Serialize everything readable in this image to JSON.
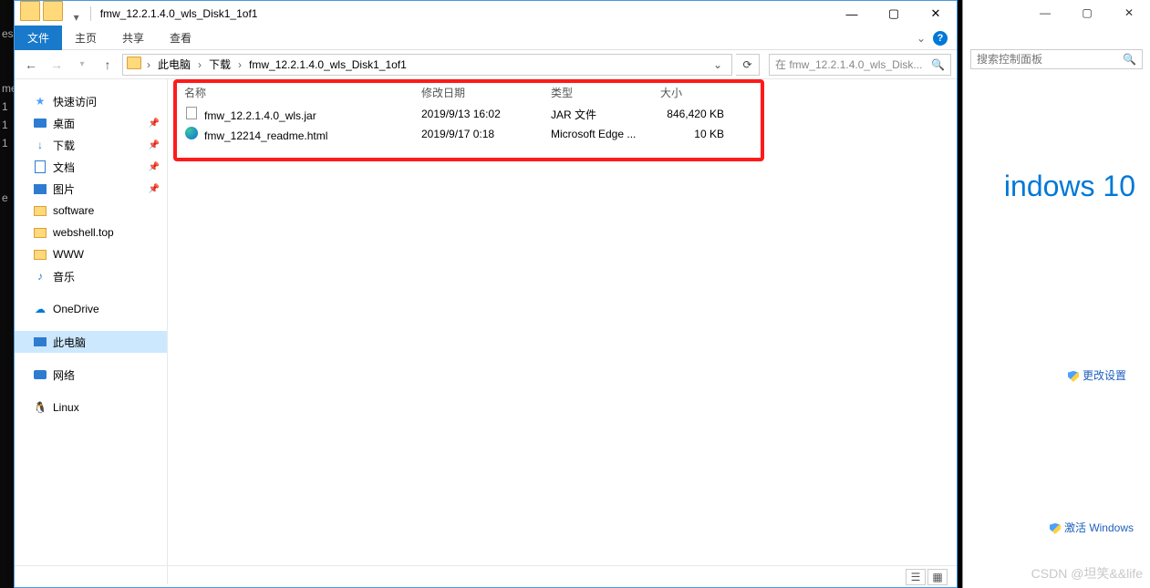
{
  "leftstrip": [
    "es",
    "",
    "",
    "me",
    "1",
    "1",
    "1",
    "",
    "",
    "e"
  ],
  "title": "fmw_12.2.1.4.0_wls_Disk1_1of1",
  "ribbon": {
    "file": "文件",
    "home": "主页",
    "share": "共享",
    "view": "查看"
  },
  "breadcrumbs": {
    "pc": "此电脑",
    "dl": "下载",
    "cur": "fmw_12.2.1.4.0_wls_Disk1_1of1"
  },
  "searchPlaceholder": "在 fmw_12.2.1.4.0_wls_Disk...",
  "cols": {
    "name": "名称",
    "date": "修改日期",
    "type": "类型",
    "size": "大小"
  },
  "rows": [
    {
      "icon": "jar",
      "name": "fmw_12.2.1.4.0_wls.jar",
      "date": "2019/9/13 16:02",
      "type": "JAR 文件",
      "size": "846,420 KB"
    },
    {
      "icon": "edge",
      "name": "fmw_12214_readme.html",
      "date": "2019/9/17 0:18",
      "type": "Microsoft Edge ...",
      "size": "10 KB"
    }
  ],
  "tree": {
    "quick": "快速访问",
    "desktop": "桌面",
    "downloads": "下载",
    "documents": "文档",
    "pictures": "图片",
    "software": "software",
    "webshell": "webshell.top",
    "www": "WWW",
    "music": "音乐",
    "onedrive": "OneDrive",
    "thispc": "此电脑",
    "network": "网络",
    "linux": "Linux"
  },
  "status": {
    "count": ""
  },
  "bg": {
    "searchPH": "搜索控制面板",
    "win10": "indows 10",
    "change": "更改设置",
    "activate": "激活 Windows"
  },
  "csdn": "CSDN @坦笑&&life"
}
